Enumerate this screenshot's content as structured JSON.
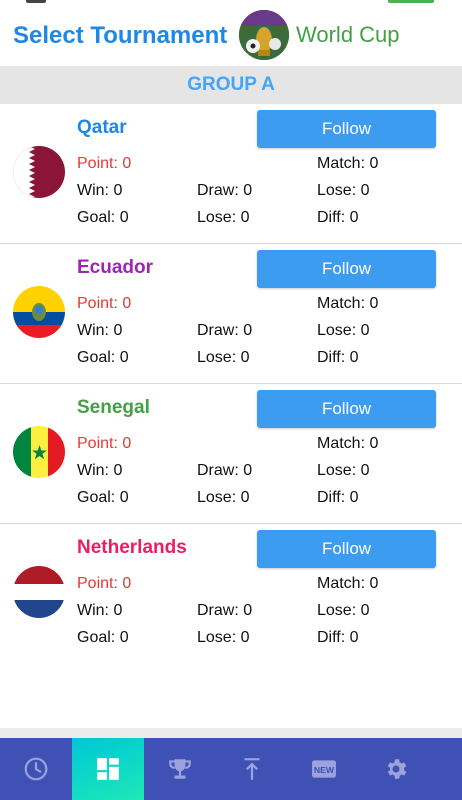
{
  "header": {
    "title": "Select Tournament",
    "tournament_name": "World Cup",
    "logo_icon": "world-cup-trophy-logo"
  },
  "group": {
    "label": "GROUP A"
  },
  "colors": {
    "title": "#1e88e5",
    "tournament": "#43a047",
    "group_label": "#42a5f5",
    "follow_button": "#3b9cf0",
    "point": "#e53935",
    "nav_bg": "#3f51b5",
    "nav_active": "#1de9b6"
  },
  "teams": [
    {
      "name": "Qatar",
      "name_color": "#1e88e5",
      "flag_icon": "qatar-flag-icon",
      "follow_label": "Follow",
      "point": "Point: 0",
      "match": "Match: 0",
      "win": "Win: 0",
      "draw": "Draw: 0",
      "lose": "Lose: 0",
      "goal": "Goal: 0",
      "goal_lose": "Lose: 0",
      "diff": "Diff: 0"
    },
    {
      "name": "Ecuador",
      "name_color": "#9c27b0",
      "flag_icon": "ecuador-flag-icon",
      "follow_label": "Follow",
      "point": "Point: 0",
      "match": "Match: 0",
      "win": "Win: 0",
      "draw": "Draw: 0",
      "lose": "Lose: 0",
      "goal": "Goal: 0",
      "goal_lose": "Lose: 0",
      "diff": "Diff: 0"
    },
    {
      "name": "Senegal",
      "name_color": "#43a047",
      "flag_icon": "senegal-flag-icon",
      "follow_label": "Follow",
      "point": "Point: 0",
      "match": "Match: 0",
      "win": "Win: 0",
      "draw": "Draw: 0",
      "lose": "Lose: 0",
      "goal": "Goal: 0",
      "goal_lose": "Lose: 0",
      "diff": "Diff: 0"
    },
    {
      "name": "Netherlands",
      "name_color": "#e91e63",
      "flag_icon": "netherlands-flag-icon",
      "follow_label": "Follow",
      "point": "Point: 0",
      "match": "Match: 0",
      "win": "Win: 0",
      "draw": "Draw: 0",
      "lose": "Lose: 0",
      "goal": "Goal: 0",
      "goal_lose": "Lose: 0",
      "diff": "Diff: 0"
    }
  ],
  "nav": {
    "items": [
      {
        "icon": "clock-icon",
        "active": false
      },
      {
        "icon": "dashboard-icon",
        "active": true
      },
      {
        "icon": "trophy-icon",
        "active": false
      },
      {
        "icon": "upload-icon",
        "active": false
      },
      {
        "icon": "new-badge-icon",
        "active": false
      },
      {
        "icon": "gear-icon",
        "active": false
      }
    ],
    "new_badge_text": "NEW"
  }
}
